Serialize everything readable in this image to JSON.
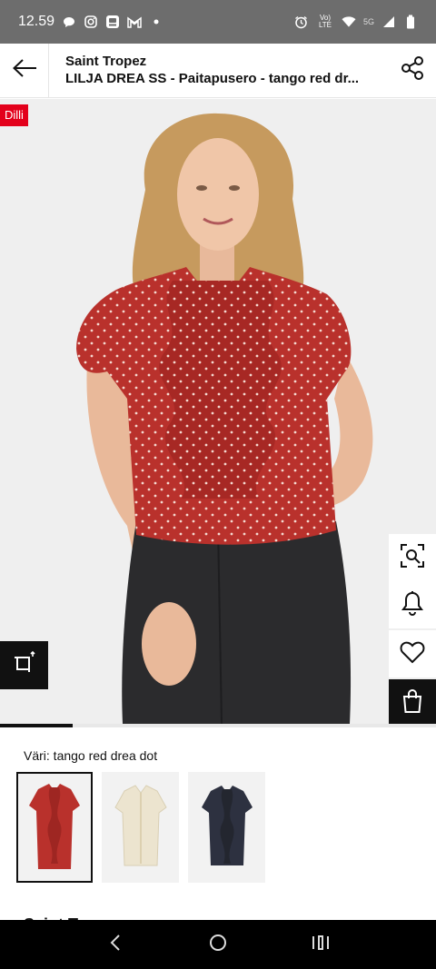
{
  "status_bar": {
    "time": "12.59",
    "left_icons": [
      "chat-bubble-icon",
      "instagram-icon",
      "app-icon",
      "gmail-icon",
      "dot-icon"
    ],
    "right_icons": [
      "alarm-icon",
      "volte-icon",
      "wifi-icon",
      "5g-icon",
      "signal-icon",
      "battery-icon"
    ],
    "network_label": "5G",
    "volte_label": "Vo) LTE"
  },
  "header": {
    "brand": "Saint Tropez",
    "title": "LILJA DREA SS - Paitapusero - tango red dr...",
    "back_icon": "arrow-left-icon",
    "share_icon": "share-icon"
  },
  "product_image": {
    "badge": "Dilli",
    "image_position": 1,
    "image_count": 6,
    "side_actions": [
      "visual-search-icon",
      "bell-icon",
      "heart-icon",
      "bag-icon"
    ],
    "rotate_icon": "rotate-view-icon"
  },
  "color": {
    "label": "Väri: tango red drea dot",
    "swatches": [
      {
        "name": "tango red drea dot",
        "color": "#b8342d",
        "selected": true
      },
      {
        "name": "cream",
        "color": "#ece4cf",
        "selected": false
      },
      {
        "name": "navy",
        "color": "#2d3140",
        "selected": false
      }
    ]
  },
  "colors": {
    "accent_red": "#e3001b",
    "dark": "#111111",
    "status_bar": "#6d6d6d"
  },
  "nav_bar": {
    "buttons": [
      "back-nav-icon",
      "home-nav-icon",
      "recents-nav-icon"
    ]
  }
}
